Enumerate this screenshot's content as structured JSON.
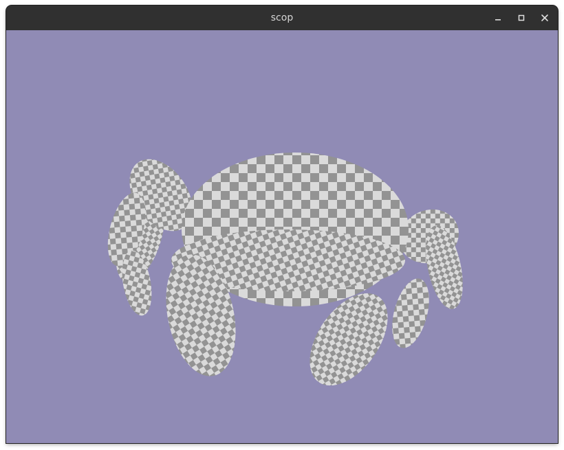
{
  "window": {
    "title": "scop"
  },
  "controls": {
    "minimize_icon": "minimize-icon",
    "maximize_icon": "maximize-icon",
    "close_icon": "close-icon"
  },
  "scene": {
    "background_color": "#908BB5",
    "checker_light": "#DADADA",
    "checker_dark": "#939393",
    "object": "turtle-model"
  }
}
